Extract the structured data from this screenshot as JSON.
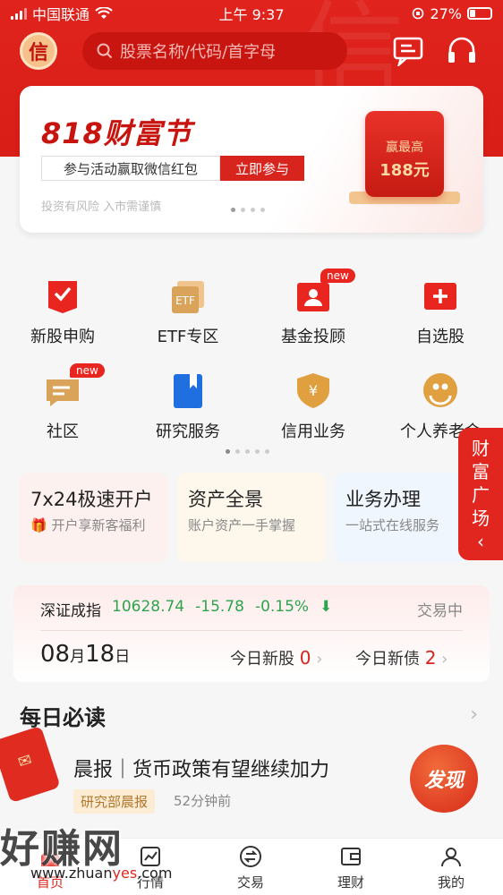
{
  "status_bar": {
    "carrier": "中国联通",
    "time": "上午 9:37",
    "battery": "27%",
    "battery_level": 0.27
  },
  "header": {
    "logo_char": "信",
    "search_placeholder": "股票名称/代码/首字母",
    "bg_char": "信"
  },
  "banner": {
    "title_num": "818",
    "title_text": "财富节",
    "bar_text": "参与活动赢取微信红包",
    "cta": "立即参与",
    "note": "投资有风险 入市需谨慎",
    "prize_label": "赢最高",
    "prize_value": "188元"
  },
  "grid": {
    "items": [
      {
        "label": "新股申购",
        "icon": "ipo-icon",
        "color": "#e8261f"
      },
      {
        "label": "ETF专区",
        "icon": "etf-icon",
        "color": "#d9a45a"
      },
      {
        "label": "基金投顾",
        "icon": "fund-advisor-icon",
        "color": "#e8261f",
        "badge": "new"
      },
      {
        "label": "自选股",
        "icon": "watchlist-icon",
        "color": "#e8261f"
      },
      {
        "label": "社区",
        "icon": "community-icon",
        "color": "#d9a45a",
        "badge": "new"
      },
      {
        "label": "研究服务",
        "icon": "research-icon",
        "color": "#1f6fe0"
      },
      {
        "label": "信用业务",
        "icon": "credit-icon",
        "color": "#e0a040"
      },
      {
        "label": "个人养老金",
        "icon": "pension-icon",
        "color": "#e0a040"
      }
    ]
  },
  "side_tab": {
    "lines": [
      "财",
      "富",
      "广",
      "场"
    ],
    "arrow": "‹"
  },
  "cards": [
    {
      "title": "7x24极速开户",
      "sub": "开户享新客福利",
      "bg": "#fdf1f0"
    },
    {
      "title": "资产全景",
      "sub": "账户资产一手掌握",
      "bg": "#fdf7ec"
    },
    {
      "title": "业务办理",
      "sub": "一站式在线服务",
      "bg": "#f0f6fd"
    }
  ],
  "index": {
    "name": "深证成指",
    "value": "10628.74",
    "change": "-15.78",
    "pct": "-0.15%",
    "status": "交易中",
    "month": "08",
    "month_unit": "月",
    "day": "18",
    "day_unit": "日",
    "new_stock_label": "今日新股",
    "new_stock_count": "0",
    "new_bond_label": "今日新债",
    "new_bond_count": "2",
    "down_color": "#2ea44f"
  },
  "daily": {
    "title": "每日必读",
    "news_title": "晨报｜货币政策有望继续加力",
    "news_tag": "研究部晨报",
    "news_time": "52分钟前",
    "promo_text": "发现"
  },
  "tabbar": {
    "items": [
      {
        "label": "首页",
        "icon": "home-icon",
        "active": true
      },
      {
        "label": "行情",
        "icon": "market-icon",
        "active": false
      },
      {
        "label": "交易",
        "icon": "trade-icon",
        "active": false
      },
      {
        "label": "理财",
        "icon": "wealth-icon",
        "active": false
      },
      {
        "label": "我的",
        "icon": "profile-icon",
        "active": false
      }
    ]
  },
  "watermark": {
    "text": "好赚网",
    "url_a": "www.zhuan",
    "url_b": "yes",
    "url_c": ".com"
  },
  "colors": {
    "brand_red": "#e0231d",
    "accent_gold": "#d9a45a"
  }
}
